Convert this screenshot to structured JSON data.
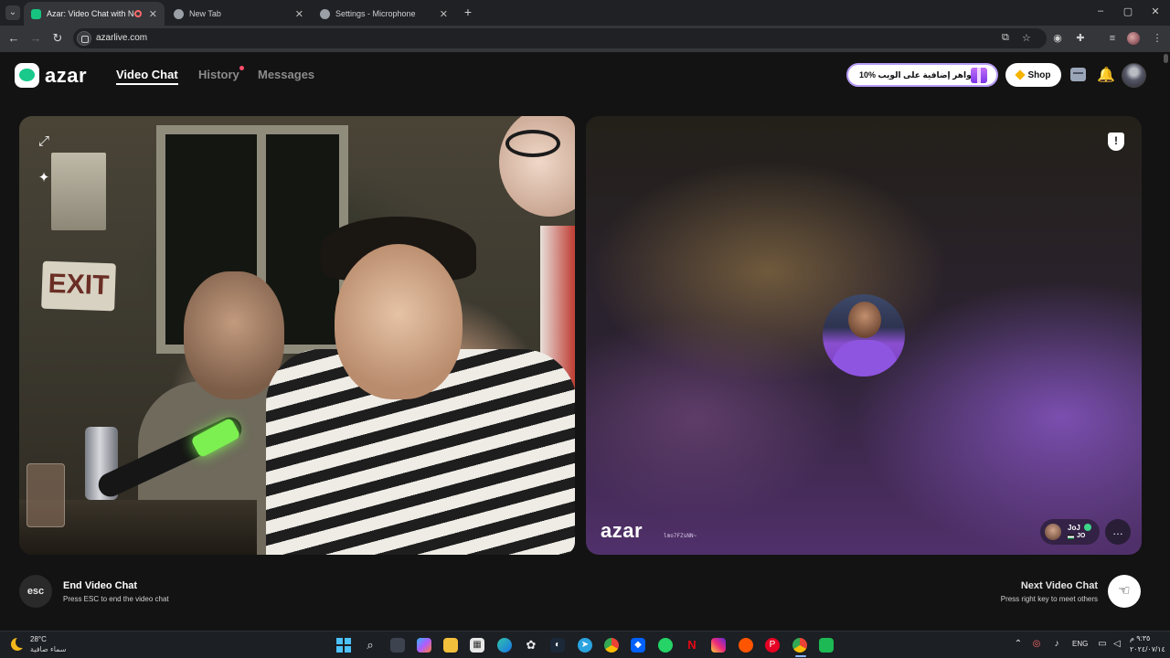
{
  "browser": {
    "tabs": [
      {
        "title": "Azar: Video Chat with New",
        "active": true,
        "favicon_color": "#17c47f"
      },
      {
        "title": "New Tab",
        "active": false,
        "favicon_color": "#9aa0a6"
      },
      {
        "title": "Settings - Microphone",
        "active": false,
        "favicon_color": "#9aa0a6"
      }
    ],
    "new_tab_icon": "+",
    "window_controls": {
      "minimize": "–",
      "maximize": "▢",
      "close": "✕"
    },
    "url": "azarlive.com"
  },
  "app": {
    "logo_text": "azar",
    "nav": {
      "video_chat": "Video Chat",
      "history": "History",
      "messages": "Messages"
    },
    "promo_text": "10% اجواهر إضافية على الويب!",
    "shop_label": "Shop",
    "accent": "#17c47f"
  },
  "peer": {
    "watermark": "azar",
    "session_id": "lmo7FZsNN~",
    "name": "JoJ",
    "country": "JO"
  },
  "controls": {
    "esc_label": "esc",
    "end_title": "End Video Chat",
    "end_subtitle": "Press ESC to end the video chat",
    "next_title": "Next Video Chat",
    "next_subtitle": "Press right key to meet others"
  },
  "taskbar": {
    "weather_temp": "28°C",
    "weather_desc": "سماء صافية",
    "language": "ENG",
    "time": "٩:٣٥ م",
    "date": "٢٠٢٤/٠٧/١٤"
  },
  "icons": {
    "expand": "⤢",
    "effects": "✦",
    "report": "!",
    "chat": "…",
    "next": "☜",
    "bell": "🔔"
  }
}
